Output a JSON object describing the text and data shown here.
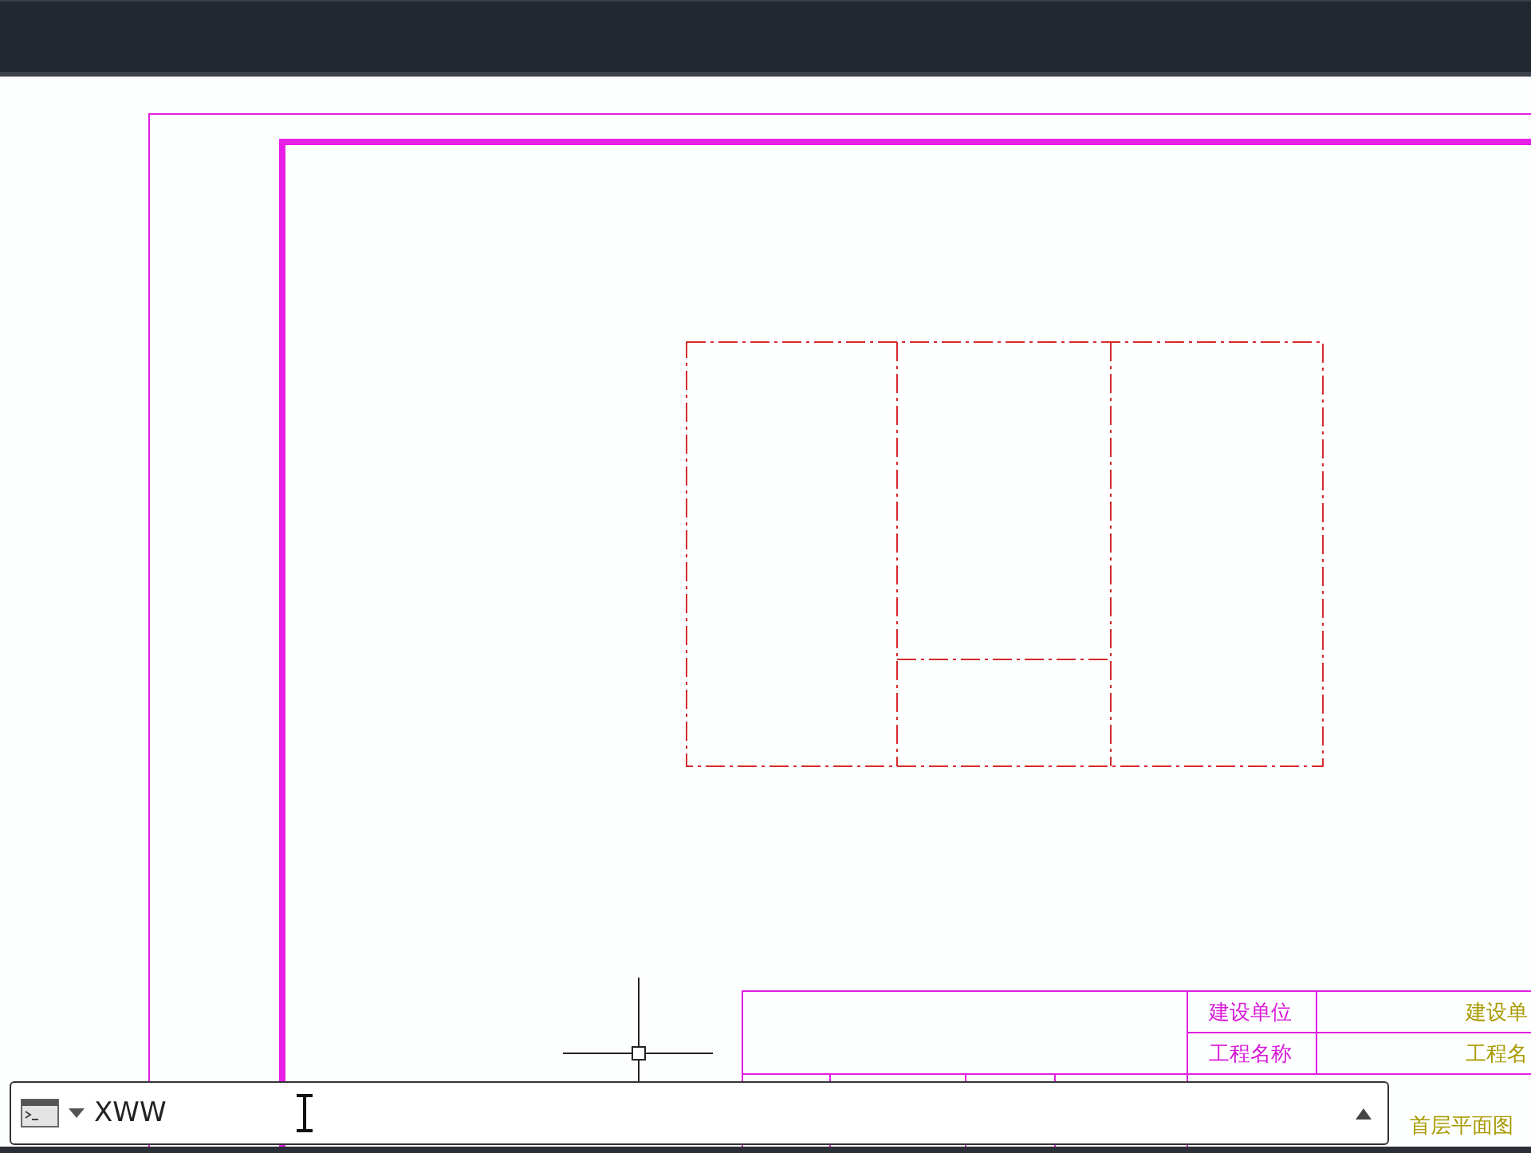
{
  "title_block": {
    "rows": [
      {
        "label": "建设单位",
        "value": "建设单"
      },
      {
        "label": "工程名称",
        "value": "工程名"
      }
    ],
    "drawing_name": "首层平面图"
  },
  "command_line": {
    "value": "XWW"
  }
}
